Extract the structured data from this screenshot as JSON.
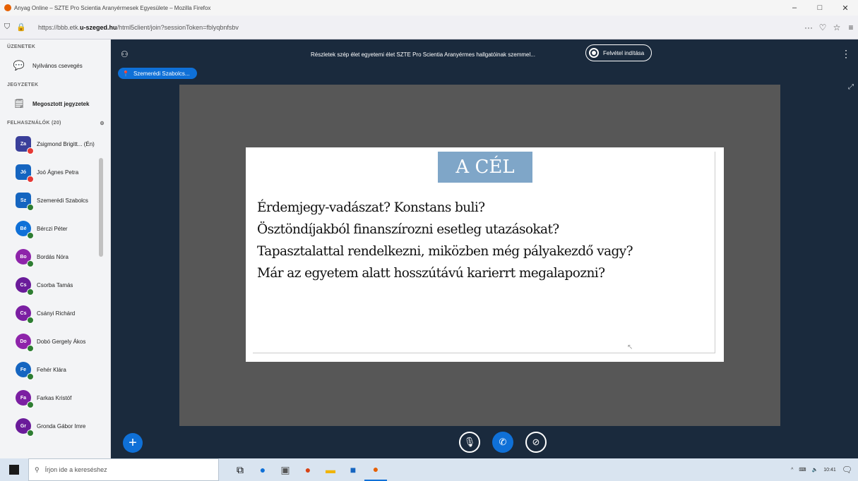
{
  "browser": {
    "title": "Anyag Online – SZTE Pro Scientia Aranyérmesek Egyesülete – Mozilla Firefox",
    "url_prefix": "https://bbb.etk.",
    "url_domain": "u-szeged.hu",
    "url_suffix": "/html5client/join?sessionToken=fblyqbnfsbv",
    "min": "–",
    "max": "□",
    "close": "✕",
    "right_icons": [
      "···",
      "♡",
      "☆",
      "≡"
    ]
  },
  "sidebar": {
    "messages_header": "ÜZENETEK",
    "public_chat": "Nyilvános csevegés",
    "notes_header": "JEGYZETEK",
    "shared_notes": "Megosztott jegyzetek",
    "users_header": "FELHASZNÁLÓK (20)",
    "users": [
      {
        "initials": "Za",
        "name": "Zsigmond Brigitt... (Én)",
        "color": "#3a3f9a",
        "square": true,
        "badge_color": "#e53935"
      },
      {
        "initials": "Jó",
        "name": "Joó Ágnes Petra",
        "color": "#1565c0",
        "square": true,
        "badge_color": "#e53935"
      },
      {
        "initials": "Sz",
        "name": "Szemerédi Szabolcs",
        "color": "#1565c0",
        "square": true,
        "badge_color": "#2e7d32"
      },
      {
        "initials": "Bé",
        "name": "Bérczi Péter",
        "color": "#0f70d7",
        "square": false,
        "badge_color": "#2e7d32"
      },
      {
        "initials": "Bo",
        "name": "Bordás Nóra",
        "color": "#8e24aa",
        "square": false,
        "badge_color": "#2e7d32"
      },
      {
        "initials": "Cs",
        "name": "Csorba Tamás",
        "color": "#6a1b9a",
        "square": false,
        "badge_color": "#2e7d32"
      },
      {
        "initials": "Cs",
        "name": "Csányi Richárd",
        "color": "#7b1fa2",
        "square": false,
        "badge_color": "#2e7d32"
      },
      {
        "initials": "Do",
        "name": "Dobó Gergely Ákos",
        "color": "#8e24aa",
        "square": false,
        "badge_color": "#2e7d32"
      },
      {
        "initials": "Fe",
        "name": "Fehér Klára",
        "color": "#1565c0",
        "square": false,
        "badge_color": "#2e7d32"
      },
      {
        "initials": "Fa",
        "name": "Farkas Kristóf",
        "color": "#7b1fa2",
        "square": false,
        "badge_color": "#2e7d32"
      },
      {
        "initials": "Gr",
        "name": "Gronda Gábor Imre",
        "color": "#6a1b9a",
        "square": false,
        "badge_color": "#2e7d32"
      }
    ]
  },
  "meeting": {
    "title": "Részletek szép élet egyetemi élet SZTE Pro Scientia Aranyérmes hallgatóinak szemmel...",
    "record_label": "Felvétel indítása",
    "presenter": "Szemerédi Szabolcs..."
  },
  "slide": {
    "title": "A CÉL",
    "lines": [
      "Érdemjegy-vadászat? Konstans buli?",
      "Ösztöndíjakból finanszírozni esetleg utazásokat?",
      "Tapasztalattal rendelkezni, miközben még pályakezdő vagy?",
      "Már az egyetem alatt hosszútávú karierrt megalapozni?"
    ]
  },
  "taskbar": {
    "search_placeholder": "Írjon ide a kereséshez",
    "clock": "10:41"
  }
}
